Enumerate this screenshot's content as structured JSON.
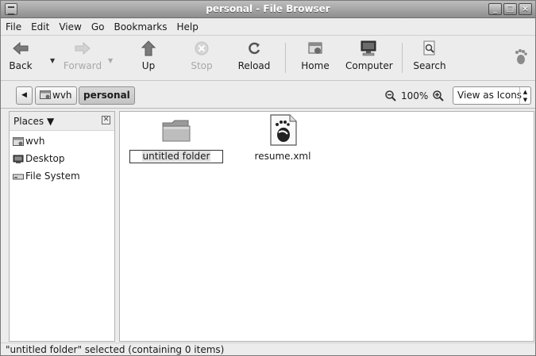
{
  "window": {
    "title": "personal - File Browser",
    "buttons": [
      "_",
      "□",
      "×"
    ]
  },
  "menubar": [
    "File",
    "Edit",
    "View",
    "Go",
    "Bookmarks",
    "Help"
  ],
  "toolbar": {
    "back": "Back",
    "forward": "Forward",
    "up": "Up",
    "stop": "Stop",
    "reload": "Reload",
    "home": "Home",
    "computer": "Computer",
    "search": "Search"
  },
  "location": {
    "path": [
      "wvh",
      "personal"
    ],
    "zoom": "100%",
    "view_mode": "View as Icons"
  },
  "sidebar": {
    "header": "Places",
    "items": [
      "wvh",
      "Desktop",
      "File System"
    ]
  },
  "files": [
    {
      "name": "untitled folder",
      "type": "folder",
      "renaming": true
    },
    {
      "name": "resume.xml",
      "type": "xml"
    }
  ],
  "status": "\"untitled folder\" selected (containing 0 items)",
  "colors": {
    "titlebar": "#9e9e9e",
    "folder": "#b5b5b5",
    "selection": "#e0e0e0"
  }
}
